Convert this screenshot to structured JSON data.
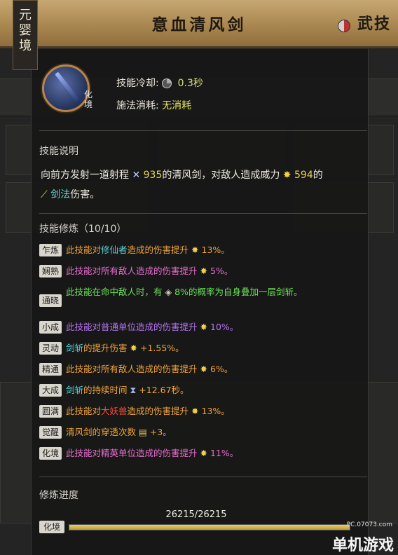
{
  "header": {
    "title": "意血清风剑",
    "tier_banner": [
      "元",
      "婴",
      "境"
    ],
    "category": "武技"
  },
  "skill": {
    "tier_mini": [
      "化",
      "境"
    ],
    "cooldown_label": "技能冷却:",
    "cooldown_value": "0.3秒",
    "cost_label": "施法消耗:",
    "cost_value": "无消耗"
  },
  "description": {
    "heading": "技能说明",
    "line1_pre": "向前方发射一道射程",
    "range_value": "935",
    "line1_mid": "的清风剑，对敌人造成威力",
    "power_value": "594",
    "line1_post": "的",
    "type_label": "剑法",
    "line2_post": "伤害。"
  },
  "training": {
    "heading": "技能修炼（10/10）",
    "rows": [
      {
        "badge": "乍炼",
        "text": "此技能对",
        "hl": "修仙者",
        "rest": "造成的伤害提升",
        "val": "13%。"
      },
      {
        "badge": "娴熟",
        "text": "此技能对",
        "hl": "所有敌人",
        "rest": "造成的伤害提升",
        "val": "5%。"
      },
      {
        "badge": "通晓",
        "text": "此技能在命中敌人时，有",
        "val": "8%的概率为自身叠加一层剑斩。"
      },
      {
        "badge": "小成",
        "text": "此技能对",
        "hl": "普通单位",
        "rest": "造成的伤害提升",
        "val": "10%。"
      },
      {
        "badge": "灵动",
        "hl": "剑斩",
        "rest": "的提升伤害",
        "val": "+1.55%。"
      },
      {
        "badge": "精通",
        "text": "此技能对",
        "hl": "所有敌人",
        "rest": "造成的伤害提升",
        "val": "6%。"
      },
      {
        "badge": "大成",
        "hl": "剑斩",
        "rest": "的持续时间",
        "val": "+12.67秒。"
      },
      {
        "badge": "圆满",
        "text": "此技能对",
        "hl": "大妖兽",
        "rest": "造成的伤害提升",
        "val": "13%。"
      },
      {
        "badge": "觉醒",
        "hl": "清风剑",
        "rest": "的穿透次数",
        "val": "+3。"
      },
      {
        "badge": "化境",
        "text": "此技能对",
        "hl": "精英单位",
        "rest": "造成的伤害提升",
        "val": "11%。"
      }
    ]
  },
  "progress": {
    "heading": "修炼进度",
    "value_text": "26215/26215",
    "badge": "化境",
    "fraction": 1.0
  },
  "watermark": {
    "url": "PC.07073.com",
    "brand": "单机游戏"
  },
  "colors": {
    "header": "#b8965f",
    "accent_gold": "#ecd063",
    "badge_bg": "#d9d6cc"
  }
}
